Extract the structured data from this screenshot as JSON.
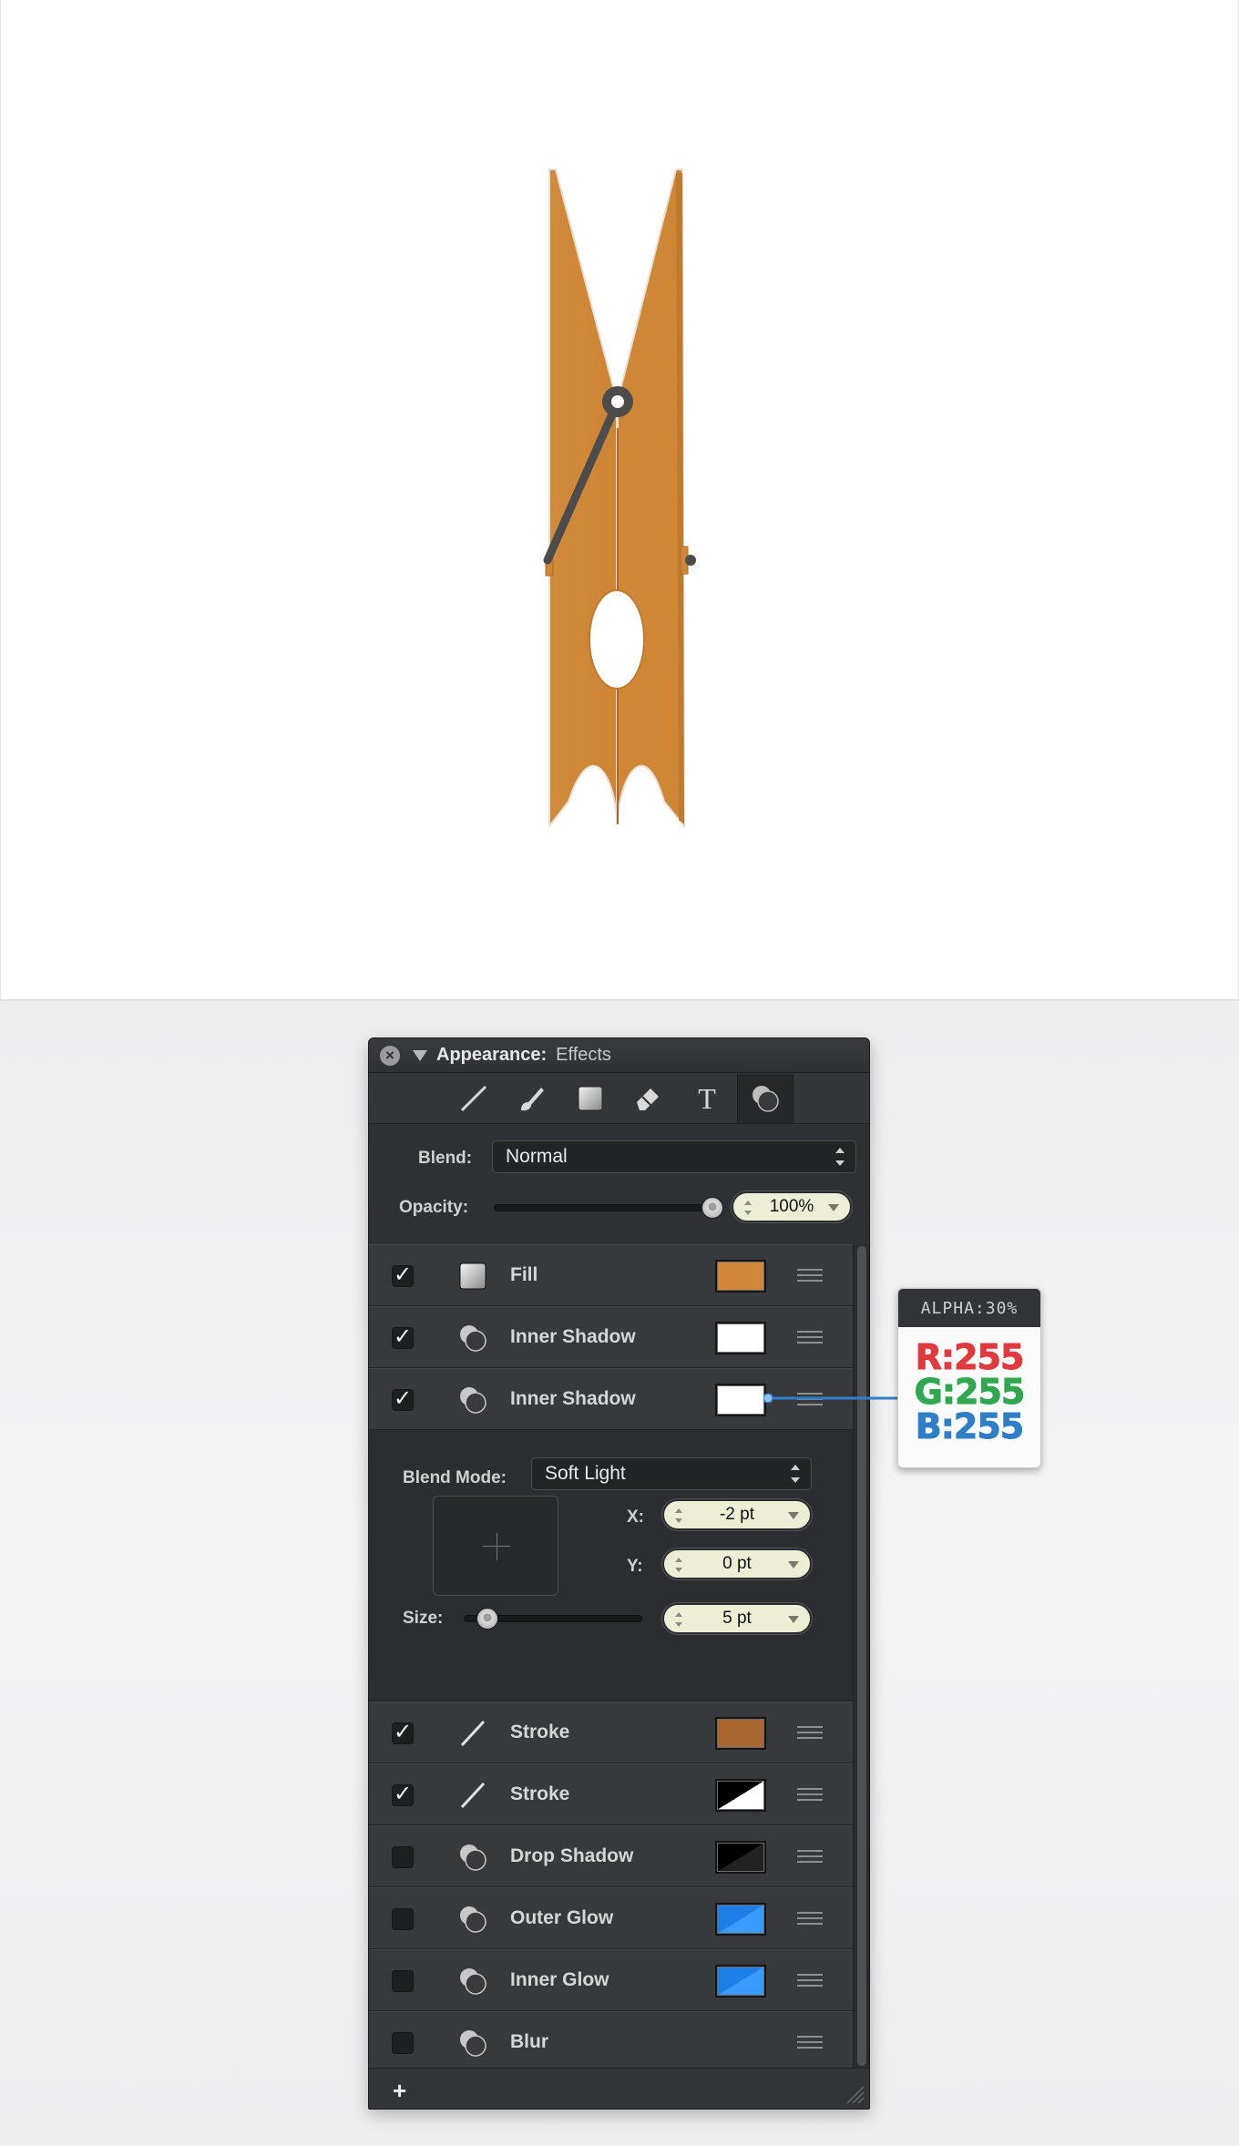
{
  "panel": {
    "title": "Appearance:",
    "subtitle": "Effects",
    "tools": [
      "stroke-tool-icon",
      "brush-tool-icon",
      "fill-tool-icon",
      "eraser-tool-icon",
      "text-tool-icon",
      "effects-tool-icon"
    ],
    "blend_label": "Blend:",
    "blend_value": "Normal",
    "opacity_label": "Opacity:",
    "opacity_value": "100%",
    "opacity_level": 1.0,
    "effects": [
      {
        "name": "Fill",
        "checked": true,
        "icon": "fill-icon",
        "swatch": "#d1873a"
      },
      {
        "name": "Inner Shadow",
        "checked": true,
        "icon": "shadow-icon",
        "swatch": "#ffffff"
      },
      {
        "name": "Inner Shadow",
        "checked": true,
        "icon": "shadow-icon",
        "swatch": "#ffffff"
      },
      {
        "name": "Stroke",
        "checked": true,
        "icon": "stroke-icon",
        "swatch": "#a8672e"
      },
      {
        "name": "Stroke",
        "checked": true,
        "icon": "stroke-icon",
        "swatch": "black-white-split"
      },
      {
        "name": "Drop Shadow",
        "checked": false,
        "icon": "shadow-icon",
        "swatch": "black-split"
      },
      {
        "name": "Outer Glow",
        "checked": false,
        "icon": "shadow-icon",
        "swatch": "blue-split"
      },
      {
        "name": "Inner Glow",
        "checked": false,
        "icon": "shadow-icon",
        "swatch": "blue-split"
      },
      {
        "name": "Blur",
        "checked": false,
        "icon": "shadow-icon",
        "swatch": null
      }
    ],
    "detail": {
      "blend_mode_label": "Blend Mode:",
      "blend_mode_value": "Soft Light",
      "x_label": "X:",
      "x_value": "-2 pt",
      "y_label": "Y:",
      "y_value": "0 pt",
      "size_label": "Size:",
      "size_value": "5 pt",
      "size_level": 0.05
    },
    "add_label": "+"
  },
  "tooltip": {
    "alpha": "ALPHA:30%",
    "r": "R:255",
    "g": "G:255",
    "b": "B:255",
    "r_color": "#e03a3e",
    "g_color": "#2fa84f",
    "b_color": "#2f7fc8"
  },
  "colors": {
    "clothespin": "#d1873a",
    "clothespin_dark": "#b06c2a",
    "spring": "#4c4c4c"
  }
}
